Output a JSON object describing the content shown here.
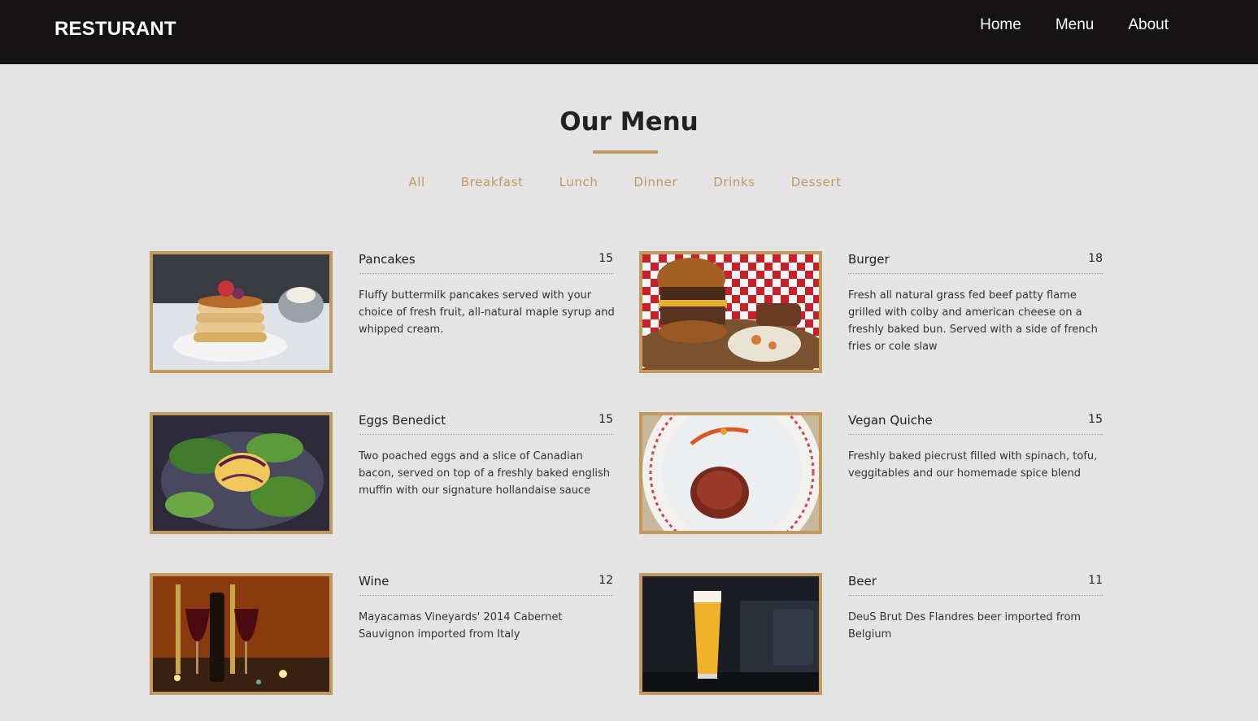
{
  "navbar": {
    "brand": "RESTURANT",
    "links": [
      "Home",
      "Menu",
      "About"
    ]
  },
  "section": {
    "title": "Our Menu",
    "filters": [
      "All",
      "Breakfast",
      "Lunch",
      "Dinner",
      "Drinks",
      "Dessert"
    ]
  },
  "items": [
    {
      "name": "Pancakes",
      "price": "15",
      "desc": "Fluffy buttermilk pancakes served with your choice of fresh fruit, all-natural maple syrup and whipped cream."
    },
    {
      "name": "Burger",
      "price": "18",
      "desc": "Fresh all natural grass fed beef patty flame grilled with colby and american cheese on a freshly baked bun. Served with a side of french fries or cole slaw"
    },
    {
      "name": "Eggs Benedict",
      "price": "15",
      "desc": "Two poached eggs and a slice of Canadian bacon, served on top of a freshly baked english muffin with our signature hollandaise sauce"
    },
    {
      "name": "Vegan Quiche",
      "price": "15",
      "desc": "Freshly baked piecrust filled with spinach, tofu, veggitables and our homemade spice blend"
    },
    {
      "name": "Wine",
      "price": "12",
      "desc": "Mayacamas Vineyards' 2014 Cabernet Sauvignon imported from Italy"
    },
    {
      "name": "Beer",
      "price": "11",
      "desc": "DeuS Brut Des Flandres beer imported from Belgium"
    }
  ],
  "colors": {
    "accent": "#c09a5f",
    "navbar": "#151313",
    "background": "#e4e4e4"
  }
}
